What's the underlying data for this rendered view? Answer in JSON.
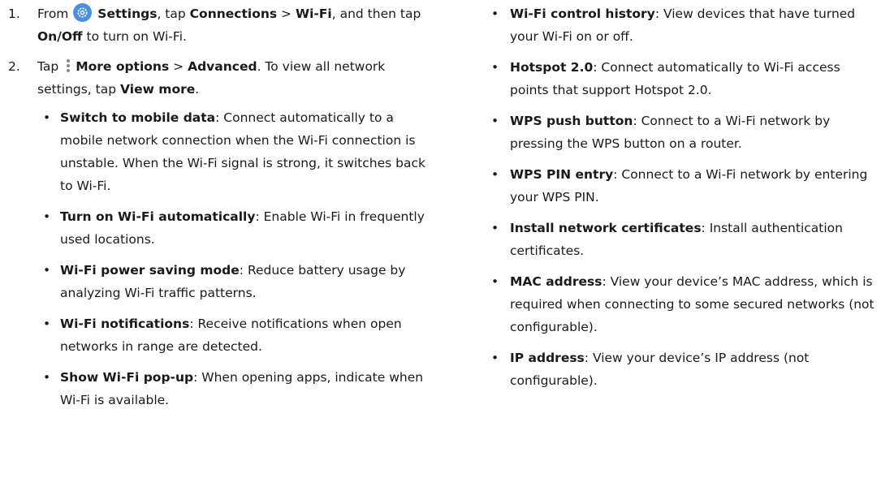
{
  "steps": [
    {
      "num": "1.",
      "from": "From",
      "settings": "Settings",
      "tap": ", tap",
      "connections": "Connections",
      "sep": ">",
      "wifi": "Wi-Fi",
      "then": ", and then tap",
      "onoff": "On/Off",
      "rest": "to turn on Wi-Fi."
    },
    {
      "num": "2.",
      "tap": "Tap",
      "more_options": "More options",
      "sep": ">",
      "advanced": "Advanced",
      "view_all": ". To view all network settings, tap",
      "view_more": "View more",
      "period": "."
    }
  ],
  "left_options": [
    {
      "name": "Switch to mobile data",
      "desc": ": Connect automatically to a mobile network connection when the Wi-Fi connection is unstable. When the Wi-Fi signal is strong, it switches back to Wi-Fi."
    },
    {
      "name": "Turn on Wi-Fi automatically",
      "desc": ": Enable Wi-Fi in frequently used locations."
    },
    {
      "name": "Wi-Fi power saving mode",
      "desc": ": Reduce battery usage by analyzing Wi-Fi traffic patterns."
    },
    {
      "name": "Wi-Fi notifications",
      "desc": ": Receive notifications when open networks in range are detected."
    },
    {
      "name": "Show Wi-Fi pop-up",
      "desc": ": When opening apps, indicate when Wi-Fi is available."
    }
  ],
  "right_options": [
    {
      "name": "Wi-Fi control history",
      "desc": ": View devices that have turned your Wi-Fi on or off."
    },
    {
      "name": "Hotspot 2.0",
      "desc": ": Connect automatically to Wi-Fi access points that support Hotspot 2.0."
    },
    {
      "name": "WPS push button",
      "desc": ": Connect to a Wi-Fi network by pressing the WPS button on a router."
    },
    {
      "name": "WPS PIN entry",
      "desc": ": Connect to a Wi-Fi network by entering your WPS PIN."
    },
    {
      "name": "Install network certificates",
      "desc": ": Install authentication certificates."
    },
    {
      "name": "MAC address",
      "desc": ": View your device’s MAC address, which is required when connecting to some secured networks (not configurable)."
    },
    {
      "name": "IP address",
      "desc": ": View your device’s IP address (not configurable)."
    }
  ],
  "icons": {
    "settings": "settings-gear-icon",
    "more": "more-options-vertical-dots-icon"
  },
  "colors": {
    "settings_icon_bg": "#4a90e2"
  }
}
